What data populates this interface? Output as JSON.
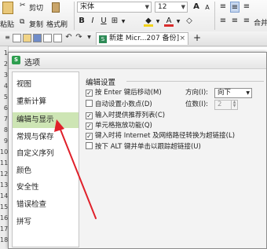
{
  "ribbon": {
    "cut_label": "剪切",
    "paste_label": "粘贴",
    "copy_label": "复制",
    "format_painter_label": "格式刷",
    "font_name": "宋体",
    "font_size": "12",
    "bold": "B",
    "italic": "I",
    "underline": "U",
    "grow_font": "A",
    "shrink_font": "A",
    "merge_label": "合并"
  },
  "qat": {
    "tab_prefix": "新建",
    "tab_title": "新建 Micr...207 备份]",
    "tab_close": "×",
    "add_tab": "+"
  },
  "sheet": {
    "row_numbers": [
      "1",
      "2",
      "3",
      "4",
      "5",
      "6",
      "7",
      "8",
      "9",
      "10",
      "11",
      "12",
      "13",
      "14",
      "15",
      "16",
      "17",
      "18"
    ]
  },
  "dialog": {
    "title": "选项",
    "nav": [
      {
        "label": "视图"
      },
      {
        "label": "重新计算"
      },
      {
        "label": "编辑与显示"
      },
      {
        "label": "常规与保存"
      },
      {
        "label": "自定义序列"
      },
      {
        "label": "颜色"
      },
      {
        "label": "安全性"
      },
      {
        "label": "错误检查"
      },
      {
        "label": "拼写"
      }
    ],
    "selected_nav": "编辑与显示",
    "section_title": "编辑设置",
    "options": [
      {
        "label": "按 Enter 键后移动(M)",
        "checked": true
      },
      {
        "label": "自动设置小数点(D)",
        "checked": false
      },
      {
        "label": "输入时提供推荐列表(C)",
        "checked": true
      },
      {
        "label": "单元格拖放功能(Q)",
        "checked": true
      },
      {
        "label": "键入时将 Internet 及网络路径转换为超链接(L)",
        "checked": true
      },
      {
        "label": "按下 ALT 键并单击以跟踪超链接(U)",
        "checked": false
      }
    ],
    "direction_label": "方向(I):",
    "direction_value": "向下",
    "decimals_label": "位数(I):",
    "decimals_value": "2"
  },
  "colors": {
    "selection": "#cde5b4",
    "arrow": "#e0202a",
    "dialog_icon": "#2e9e4f"
  }
}
